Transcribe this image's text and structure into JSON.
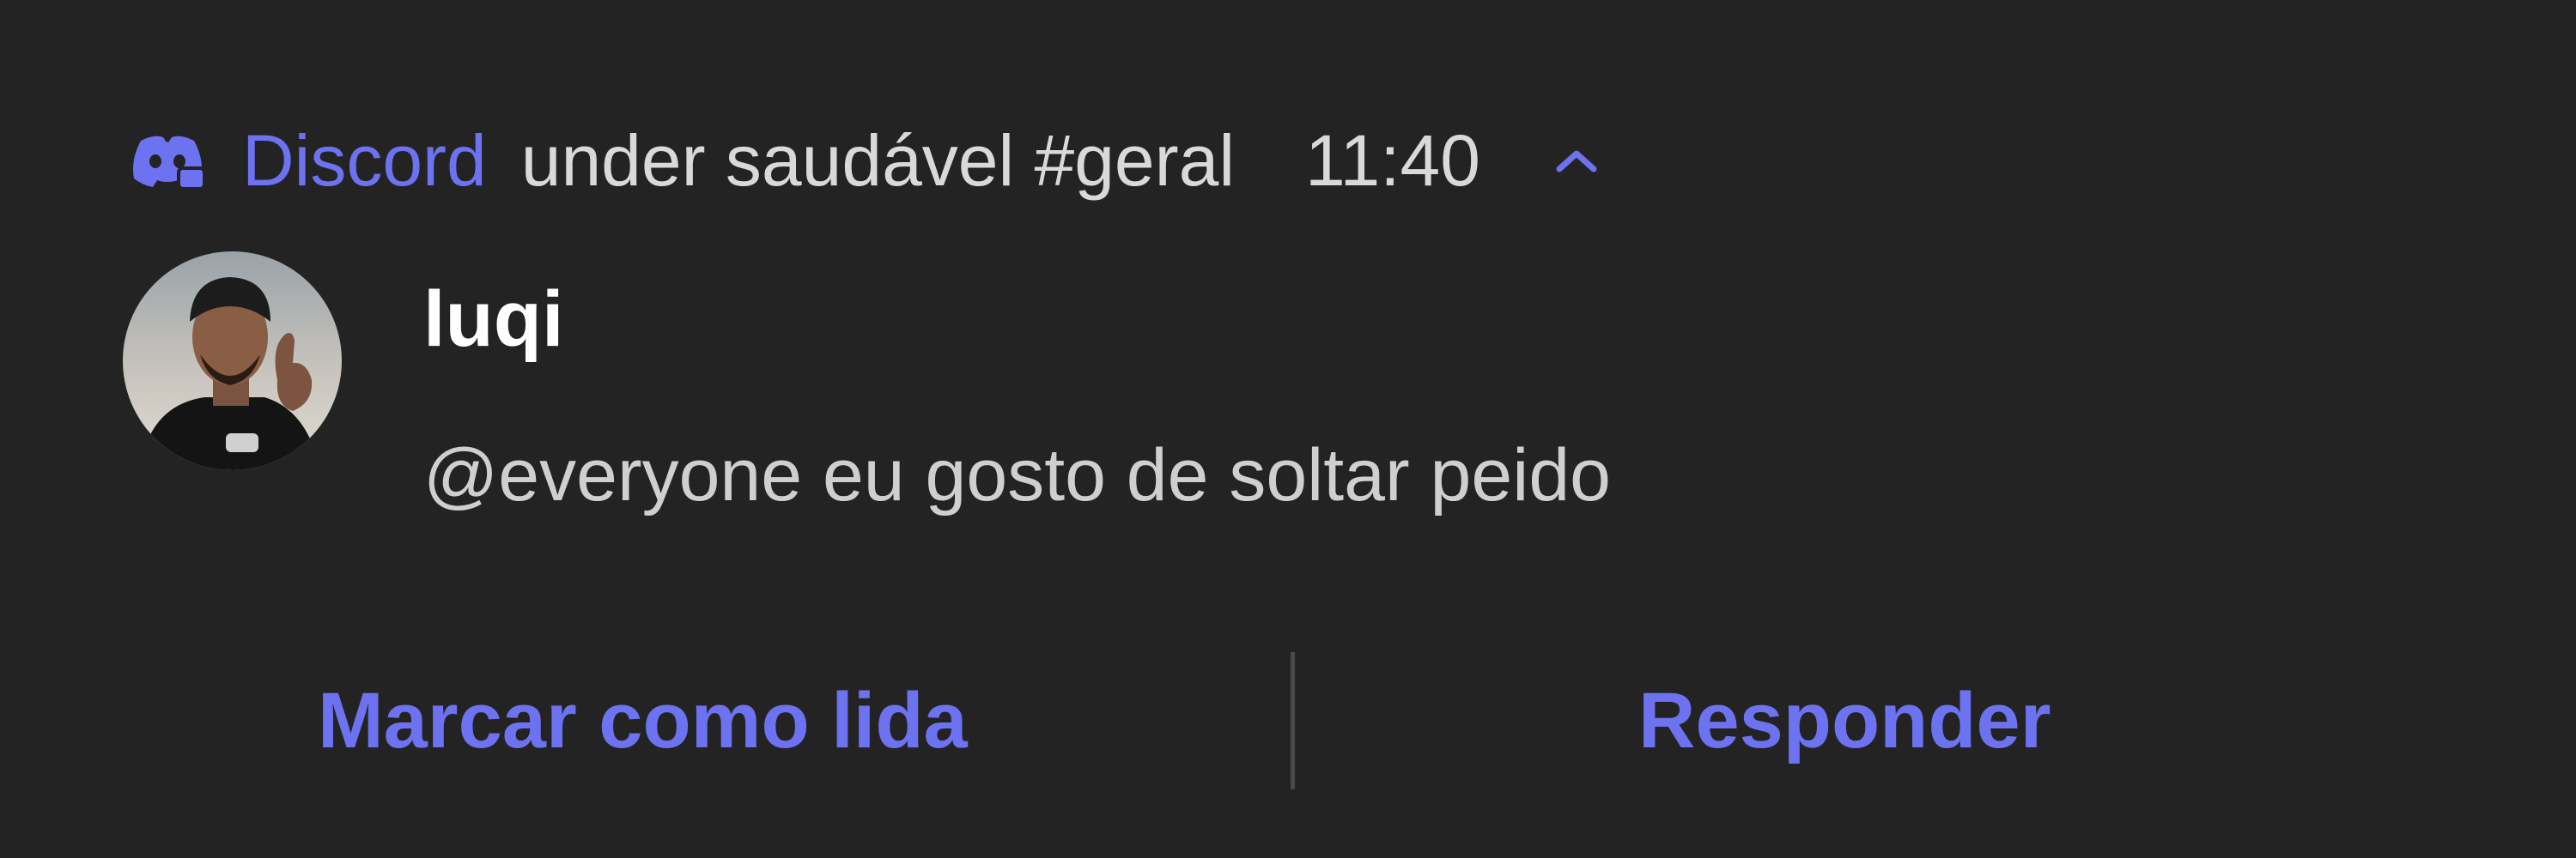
{
  "notification": {
    "app_name": "Discord",
    "channel": "under saudável #geral",
    "time": "11:40",
    "app_icon": "discord-icon",
    "expand_icon": "chevron-up-icon",
    "sender": "luqi",
    "message": "@everyone eu gosto de soltar peido",
    "actions": {
      "mark_read": "Marcar como lida",
      "reply": "Responder"
    },
    "colors": {
      "accent": "#6d72f0",
      "background": "#232323",
      "primary_text": "#ffffff",
      "secondary_text": "#d9d9d9"
    }
  }
}
